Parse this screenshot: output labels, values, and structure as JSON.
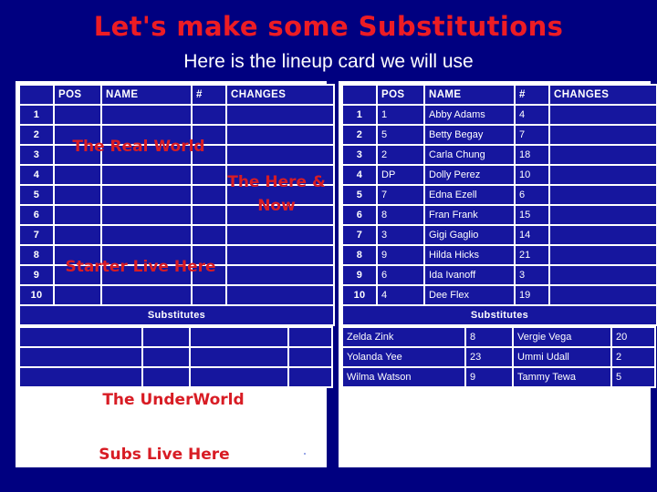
{
  "slide": {
    "title": "Let's make some Substitutions",
    "subtitle": "Here is the lineup card we will use",
    "background_color": "#000080",
    "accent_color": "#ED1C24",
    "cell_color": "#16169E",
    "grid_color": "#FFFFFF"
  },
  "columns": {
    "rownum": "",
    "pos": "POS",
    "name": "NAME",
    "number": "#",
    "changes": "CHANGES"
  },
  "left_card": {
    "label": "blank-lineup-card",
    "rows": [
      {
        "num": "1",
        "pos": "",
        "name": "",
        "number": "",
        "changes": ""
      },
      {
        "num": "2",
        "pos": "",
        "name": "",
        "number": "",
        "changes": ""
      },
      {
        "num": "3",
        "pos": "",
        "name": "",
        "number": "",
        "changes": ""
      },
      {
        "num": "4",
        "pos": "",
        "name": "",
        "number": "",
        "changes": ""
      },
      {
        "num": "5",
        "pos": "",
        "name": "",
        "number": "",
        "changes": ""
      },
      {
        "num": "6",
        "pos": "",
        "name": "",
        "number": "",
        "changes": ""
      },
      {
        "num": "7",
        "pos": "",
        "name": "",
        "number": "",
        "changes": ""
      },
      {
        "num": "8",
        "pos": "",
        "name": "",
        "number": "",
        "changes": ""
      },
      {
        "num": "9",
        "pos": "",
        "name": "",
        "number": "",
        "changes": ""
      },
      {
        "num": "10",
        "pos": "",
        "name": "",
        "number": "",
        "changes": ""
      }
    ],
    "substitutes_header": "Substitutes",
    "substitutes": [
      {
        "name1": "",
        "num1": "",
        "name2": "",
        "num2": ""
      },
      {
        "name1": "",
        "num1": "",
        "name2": "",
        "num2": ""
      },
      {
        "name1": "",
        "num1": "",
        "name2": "",
        "num2": ""
      }
    ],
    "annotations": {
      "real_world": "The Real World",
      "starter_live_here": "Starter Live Here",
      "here_and_now": "The Here & Now",
      "underworld": "The UnderWorld",
      "subs_live_here": "Subs Live Here"
    }
  },
  "right_card": {
    "label": "filled-lineup-card",
    "rows": [
      {
        "num": "1",
        "pos": "1",
        "name": "Abby Adams",
        "number": "4",
        "changes": ""
      },
      {
        "num": "2",
        "pos": "5",
        "name": "Betty Begay",
        "number": "7",
        "changes": ""
      },
      {
        "num": "3",
        "pos": "2",
        "name": "Carla Chung",
        "number": "18",
        "changes": ""
      },
      {
        "num": "4",
        "pos": "DP",
        "name": "Dolly Perez",
        "number": "10",
        "changes": ""
      },
      {
        "num": "5",
        "pos": "7",
        "name": "Edna Ezell",
        "number": "6",
        "changes": ""
      },
      {
        "num": "6",
        "pos": "8",
        "name": "Fran Frank",
        "number": "15",
        "changes": ""
      },
      {
        "num": "7",
        "pos": "3",
        "name": "Gigi Gaglio",
        "number": "14",
        "changes": ""
      },
      {
        "num": "8",
        "pos": "9",
        "name": "Hilda Hicks",
        "number": "21",
        "changes": ""
      },
      {
        "num": "9",
        "pos": "6",
        "name": "Ida Ivanoff",
        "number": "3",
        "changes": ""
      },
      {
        "num": "10",
        "pos": "4",
        "name": "Dee Flex",
        "number": "19",
        "changes": ""
      }
    ],
    "substitutes_header": "Substitutes",
    "substitutes": [
      {
        "name1": "Zelda Zink",
        "num1": "8",
        "name2": "Vergie Vega",
        "num2": "20"
      },
      {
        "name1": "Yolanda Yee",
        "num1": "23",
        "name2": "Ummi Udall",
        "num2": "2"
      },
      {
        "name1": "Wilma Watson",
        "num1": "9",
        "name2": "Tammy Tewa",
        "num2": "5"
      }
    ]
  }
}
